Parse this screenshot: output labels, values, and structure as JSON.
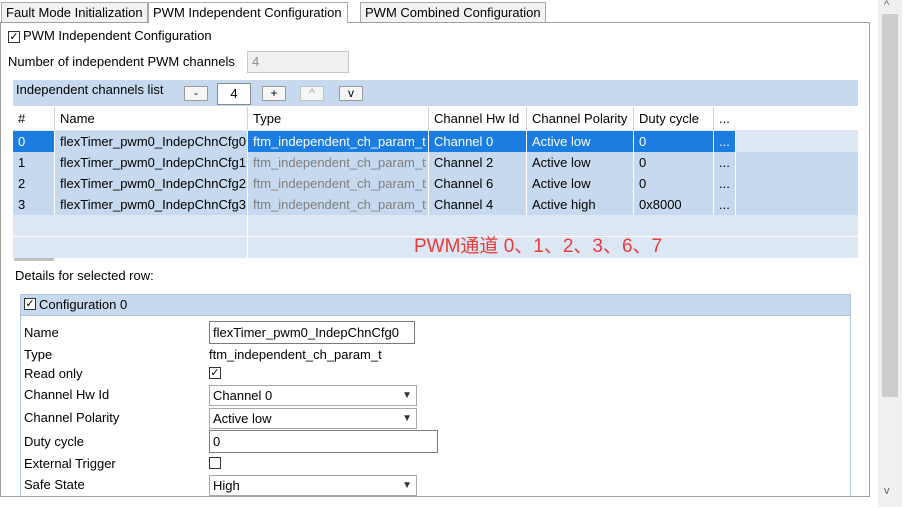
{
  "tabs": [
    {
      "label": "Fault Mode Initialization"
    },
    {
      "label": "PWM Independent Configuration"
    },
    {
      "label": "PWM Combined Configuration"
    }
  ],
  "independent": {
    "checkbox_label": "PWM Independent Configuration",
    "channels_label": "Number of independent PWM channels",
    "channels_value": "4"
  },
  "toolbar": {
    "title": "Independent channels list",
    "minus": "-",
    "count": "4",
    "plus": "+",
    "up": "^",
    "down": "v"
  },
  "table": {
    "columns": [
      "#",
      "Name",
      "Type",
      "Channel Hw Id",
      "Channel Polarity",
      "Duty cycle",
      "..."
    ],
    "rows": [
      {
        "num": "0",
        "name": "flexTimer_pwm0_IndepChnCfg0",
        "type": "ftm_independent_ch_param_t",
        "hwid": "Channel 0",
        "polarity": "Active low",
        "duty": "0",
        "more": "..."
      },
      {
        "num": "1",
        "name": "flexTimer_pwm0_IndepChnCfg1",
        "type": "ftm_independent_ch_param_t",
        "hwid": "Channel 2",
        "polarity": "Active low",
        "duty": "0",
        "more": "..."
      },
      {
        "num": "2",
        "name": "flexTimer_pwm0_IndepChnCfg2",
        "type": "ftm_independent_ch_param_t",
        "hwid": "Channel 6",
        "polarity": "Active low",
        "duty": "0",
        "more": "..."
      },
      {
        "num": "3",
        "name": "flexTimer_pwm0_IndepChnCfg3",
        "type": "ftm_independent_ch_param_t",
        "hwid": "Channel 4",
        "polarity": "Active high",
        "duty": "0x8000",
        "more": "..."
      }
    ]
  },
  "annotation": "PWM通道 0、1、2、3、6、7",
  "details": {
    "heading": "Details for selected row:",
    "section_title": "Configuration 0",
    "fields": {
      "name_label": "Name",
      "name_value": "flexTimer_pwm0_IndepChnCfg0",
      "type_label": "Type",
      "type_value": "ftm_independent_ch_param_t",
      "readonly_label": "Read only",
      "hwid_label": "Channel Hw Id",
      "hwid_value": "Channel 0",
      "polarity_label": "Channel Polarity",
      "polarity_value": "Active low",
      "duty_label": "Duty cycle",
      "duty_value": "0",
      "trigger_label": "External Trigger",
      "safe_label": "Safe State",
      "safe_value": "High"
    }
  },
  "colors": {
    "selection": "#1a7ddf",
    "row_alt": "#c6d9ee",
    "annotation": "#e53b3b"
  },
  "icons": {
    "checkbox_checked": "check-icon",
    "dropdown": "chevron-down-icon"
  }
}
